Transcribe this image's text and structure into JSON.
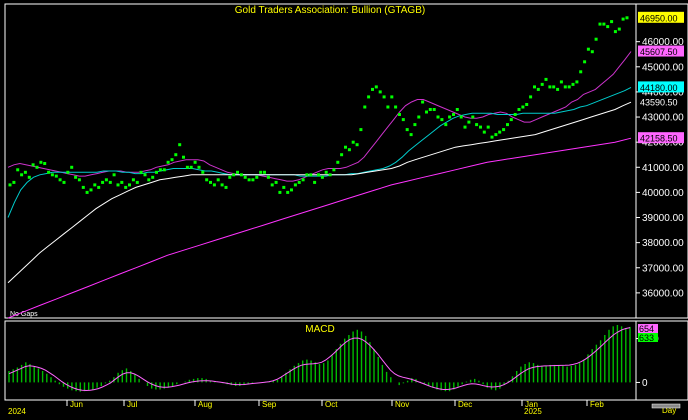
{
  "chart_data": [
    {
      "type": "scatter",
      "title": "Gold Traders Association: Bullion (GTAGB)",
      "note": "No Gaps",
      "ylim": [
        35000,
        47500
      ],
      "yticks": [
        "36000.00",
        "37000.00",
        "38000.00",
        "39000.00",
        "40000.00",
        "41000.00",
        "42000.00",
        "43000.00",
        "44000.00",
        "45000.00",
        "46000.00"
      ],
      "x_months": [
        "Jun",
        "Jul",
        "Aug",
        "Sep",
        "Oct",
        "Nov",
        "Dec",
        "Jan",
        "Feb"
      ],
      "x_years": [
        "2024",
        "2025"
      ],
      "x_period": "Day",
      "price": [
        40300,
        40400,
        40900,
        40700,
        40800,
        40600,
        41100,
        41000,
        41200,
        41150,
        40800,
        40700,
        40650,
        40500,
        40400,
        40800,
        41000,
        40600,
        40500,
        40200,
        40000,
        40100,
        40300,
        40200,
        40400,
        40500,
        40400,
        40700,
        40300,
        40400,
        40200,
        40300,
        40500,
        40400,
        40800,
        40700,
        40500,
        40600,
        40800,
        40900,
        40900,
        41200,
        41300,
        41500,
        41900,
        41400,
        41000,
        41000,
        41200,
        41000,
        40800,
        40500,
        40400,
        40300,
        40500,
        40300,
        40200,
        40600,
        40700,
        40800,
        40700,
        40600,
        40500,
        40500,
        40600,
        40800,
        40800,
        40600,
        40300,
        40400,
        40000,
        40200,
        40000,
        40100,
        40300,
        40400,
        40500,
        40700,
        40700,
        40400,
        40700,
        40600,
        40800,
        40700,
        40900,
        41200,
        41500,
        41800,
        41700,
        42000,
        41900,
        42500,
        43400,
        43800,
        44100,
        44200,
        44000,
        43800,
        43400,
        43800,
        43400,
        43100,
        42900,
        42500,
        42300,
        42700,
        43000,
        43600,
        43200,
        43300,
        43300,
        43000,
        42900,
        42700,
        43000,
        43100,
        43300,
        43000,
        42600,
        42800,
        43000,
        42700,
        42600,
        42400,
        42600,
        42200,
        42300,
        42400,
        42500,
        42700,
        42900,
        43100,
        43300,
        43400,
        43500,
        43800,
        44200,
        44100,
        44300,
        44500,
        44200,
        44200,
        44100,
        44400,
        44200,
        44200,
        44300,
        44400,
        44800,
        45200,
        45700,
        45600,
        46100,
        46700,
        46700,
        46600,
        46800,
        46400,
        46500,
        46900,
        46950
      ],
      "series": [
        {
          "name": "45607.50",
          "color": "#cc33cc",
          "values": [
            41000,
            41100,
            41150,
            41100,
            41050,
            41000,
            40950,
            40900,
            40850,
            40800,
            40750,
            40700,
            40650,
            40650,
            40700,
            40750,
            40800,
            40850,
            40850,
            40850,
            40800,
            40800,
            40800,
            40850,
            40900,
            41000,
            41050,
            41100,
            41200,
            41250,
            41300,
            41300,
            41300,
            41250,
            41100,
            41000,
            40900,
            40800,
            40750,
            40700,
            40700,
            40700,
            40700,
            40650,
            40600,
            40550,
            40500,
            40450,
            40450,
            40500,
            40600,
            40700,
            40800,
            40900,
            40950,
            40950,
            40950,
            41000,
            41100,
            41200,
            41400,
            41700,
            42000,
            42300,
            42600,
            42900,
            43200,
            43450,
            43600,
            43700,
            43700,
            43600,
            43500,
            43400,
            43300,
            43200,
            43100,
            43000,
            42950,
            42950,
            43000,
            43100,
            43150,
            43200,
            43150,
            43000,
            42900,
            42800,
            42800,
            42900,
            43000,
            43100,
            43200,
            43300,
            43400,
            43600,
            43700,
            43900,
            44000,
            44100,
            44300,
            44500,
            44700,
            45000,
            45300,
            45607.5
          ]
        },
        {
          "name": "44180.00",
          "color": "#00cccc",
          "values": [
            39000,
            39600,
            40100,
            40400,
            40600,
            40700,
            40750,
            40800,
            40800,
            40800,
            40800,
            40800,
            40800,
            40800,
            40800,
            40850,
            40850,
            40850,
            40800,
            40800,
            40750,
            40750,
            40800,
            40800,
            40850,
            40900,
            40950,
            40950,
            40950,
            40950,
            40900,
            40850,
            40850,
            40800,
            40750,
            40700,
            40700,
            40700,
            40700,
            40700,
            40700,
            40700,
            40700,
            40700,
            40700,
            40700,
            40650,
            40650,
            40650,
            40650,
            40650,
            40700,
            40700,
            40700,
            40750,
            40750,
            40800,
            40850,
            40900,
            40950,
            41050,
            41200,
            41400,
            41650,
            41850,
            42050,
            42250,
            42450,
            42650,
            42800,
            42950,
            43050,
            43100,
            43150,
            43150,
            43150,
            43150,
            43100,
            43100,
            43100,
            43100,
            43150,
            43150,
            43150,
            43150,
            43150,
            43150,
            43200,
            43250,
            43300,
            43400,
            43450,
            43550,
            43650,
            43750,
            43850,
            43950,
            44050,
            44180
          ]
        },
        {
          "name": "43590.50",
          "color": "#ffffff",
          "values": [
            36400,
            36700,
            37000,
            37300,
            37600,
            37850,
            38100,
            38350,
            38600,
            38850,
            39100,
            39350,
            39550,
            39750,
            39900,
            40050,
            40200,
            40300,
            40400,
            40500,
            40550,
            40600,
            40650,
            40700,
            40700,
            40700,
            40700,
            40700,
            40700,
            40700,
            40700,
            40700,
            40700,
            40700,
            40700,
            40700,
            40700,
            40700,
            40700,
            40700,
            40700,
            40700,
            40700,
            40700,
            40750,
            40800,
            40850,
            40900,
            40950,
            41050,
            41200,
            41300,
            41400,
            41500,
            41600,
            41700,
            41800,
            41850,
            41900,
            41950,
            42000,
            42050,
            42100,
            42150,
            42200,
            42250,
            42300,
            42400,
            42500,
            42600,
            42700,
            42800,
            42900,
            43000,
            43100,
            43200,
            43300,
            43450,
            43590.5
          ]
        },
        {
          "name": "42158.50",
          "color": "#ff33ff",
          "values": [
            35000,
            35250,
            35500,
            35750,
            36000,
            36250,
            36500,
            36750,
            37000,
            37250,
            37500,
            37700,
            37900,
            38100,
            38300,
            38500,
            38700,
            38900,
            39100,
            39300,
            39500,
            39700,
            39900,
            40100,
            40300,
            40450,
            40600,
            40750,
            40900,
            41050,
            41200,
            41300,
            41400,
            41500,
            41600,
            41700,
            41800,
            41900,
            42000,
            42158.5
          ]
        }
      ],
      "last_value": "46950.00"
    },
    {
      "type": "bar",
      "title": "MACD",
      "ylim": [
        -200,
        700
      ],
      "yticks": [
        "0",
        "500"
      ],
      "labels": [
        {
          "text": "654",
          "color": "#ff66ff"
        },
        {
          "text": "633",
          "color": "#00ff00"
        }
      ],
      "values": [
        130,
        150,
        170,
        200,
        230,
        210,
        180,
        160,
        130,
        100,
        60,
        20,
        -20,
        -50,
        -70,
        -90,
        -100,
        -105,
        -100,
        -90,
        -80,
        -60,
        -40,
        -10,
        20,
        60,
        110,
        140,
        160,
        130,
        90,
        40,
        0,
        -40,
        -70,
        -80,
        -80,
        -70,
        -60,
        -40,
        -20,
        0,
        10,
        30,
        40,
        50,
        50,
        40,
        20,
        10,
        0,
        -10,
        -20,
        -30,
        -40,
        -40,
        -30,
        -20,
        -10,
        0,
        0,
        10,
        10,
        20,
        30,
        60,
        110,
        150,
        190,
        220,
        250,
        260,
        250,
        230,
        210,
        220,
        250,
        310,
        380,
        440,
        500,
        540,
        580,
        600,
        580,
        530,
        460,
        380,
        290,
        200,
        120,
        60,
        0,
        -30,
        -10,
        20,
        50,
        40,
        10,
        -20,
        -40,
        -60,
        -80,
        -90,
        -100,
        -100,
        -80,
        -50,
        -20,
        10,
        30,
        40,
        20,
        -20,
        -60,
        -80,
        -90,
        -70,
        -30,
        20,
        70,
        130,
        180,
        210,
        230,
        220,
        200,
        190,
        190,
        200,
        200,
        190,
        190,
        180,
        190,
        200,
        220,
        260,
        320,
        380,
        430,
        480,
        540,
        600,
        640,
        654,
        640,
        620,
        633
      ],
      "signal": [
        100,
        120,
        140,
        160,
        180,
        190,
        185,
        175,
        160,
        140,
        110,
        80,
        45,
        10,
        -20,
        -45,
        -65,
        -80,
        -90,
        -92,
        -90,
        -82,
        -70,
        -52,
        -30,
        -5,
        30,
        65,
        95,
        110,
        110,
        95,
        70,
        40,
        10,
        -15,
        -35,
        -48,
        -55,
        -55,
        -50,
        -40,
        -30,
        -18,
        -5,
        5,
        12,
        18,
        20,
        19,
        16,
        10,
        4,
        -4,
        -12,
        -20,
        -25,
        -25,
        -23,
        -18,
        -12,
        -7,
        -3,
        2,
        8,
        18,
        35,
        60,
        90,
        120,
        150,
        175,
        195,
        205,
        210,
        212,
        218,
        230,
        255,
        290,
        330,
        375,
        420,
        460,
        490,
        505,
        505,
        490,
        460,
        420,
        370,
        315,
        255,
        195,
        140,
        100,
        75,
        60,
        50,
        38,
        22,
        5,
        -12,
        -30,
        -48,
        -62,
        -74,
        -80,
        -80,
        -75,
        -65,
        -50,
        -35,
        -22,
        -15,
        -18,
        -27,
        -38,
        -47,
        -52,
        -50,
        -42,
        -25,
        0,
        30,
        65,
        100,
        130,
        155,
        170,
        180,
        185,
        188,
        190,
        192,
        193,
        194,
        195,
        198,
        205,
        218,
        238,
        265,
        298,
        335,
        375,
        418,
        462,
        505,
        545,
        575,
        600,
        615,
        625
      ]
    }
  ]
}
